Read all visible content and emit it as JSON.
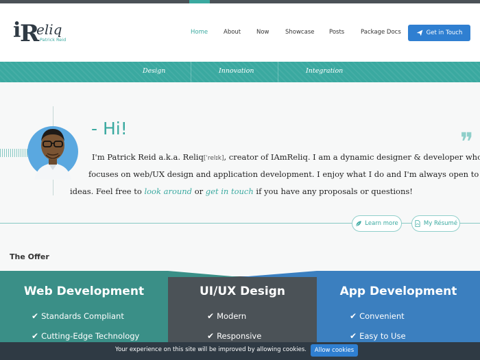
{
  "brand": {
    "logo_i": "i",
    "logo_r": "R",
    "logo_rest": "eliq",
    "tagline": "Patrick Reid"
  },
  "nav": {
    "items": [
      {
        "label": "Home",
        "active": true
      },
      {
        "label": "About"
      },
      {
        "label": "Now"
      },
      {
        "label": "Showcase"
      },
      {
        "label": "Posts"
      },
      {
        "label": "Package Docs"
      }
    ],
    "cta_label": "Get in Touch"
  },
  "band": {
    "items": [
      "Design",
      "Innovation",
      "Integration"
    ]
  },
  "intro": {
    "greeting": "- Hi!",
    "quote_mark": "❞",
    "line1_a": "I'm Patrick Reid a.k.a. Reliq",
    "phonetic": "[ˈrelɪk]",
    "line1_b": ", creator of IAmReliq. I am a dynamic designer & developer who",
    "line2": "focuses on web/UX design and application development. I enjoy what I do and I'm always open to new",
    "line3_a": "ideas. Feel free to ",
    "link_look": "look around",
    "line3_b": " or ",
    "link_touch": "get in touch",
    "line3_c": " if you have any proposals or questions!",
    "learn_more": "Learn more",
    "resume": "My Résumé"
  },
  "offer": {
    "title": "The Offer",
    "cards": [
      {
        "title": "Web Development",
        "items": [
          "Standards Compliant",
          "Cutting-Edge Technology"
        ],
        "color": "#3a8f87"
      },
      {
        "title": "UI/UX Design",
        "items": [
          "Modern",
          "Responsive"
        ],
        "color": "#4b5257"
      },
      {
        "title": "App Development",
        "items": [
          "Convenient",
          "Easy to Use"
        ],
        "color": "#3b7fbf"
      }
    ]
  },
  "cookie": {
    "text": "Your experience on this site will be improved by allowing cookies.",
    "button": "Allow cookies"
  },
  "colors": {
    "accent": "#3aa9a0",
    "primary_button": "#2f7fd1",
    "dark": "#2f3a44"
  }
}
